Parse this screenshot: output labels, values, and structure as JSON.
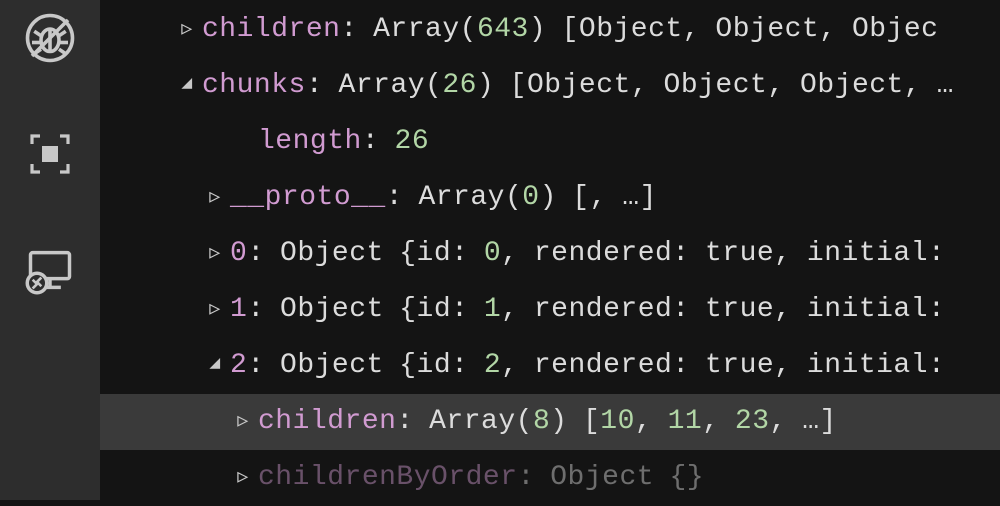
{
  "sidebar": {
    "icons": [
      "no-bug",
      "expand-region",
      "remote"
    ]
  },
  "rows": [
    {
      "indent": 72,
      "twisty": "closed",
      "highlight": false,
      "faded": false,
      "tokens": [
        [
          "key",
          "children"
        ],
        [
          "punc",
          ":"
        ],
        [
          "sp",
          ""
        ],
        [
          "type",
          "Array"
        ],
        [
          "punc",
          "("
        ],
        [
          "num",
          "643"
        ],
        [
          "punc",
          ")"
        ],
        [
          "sp",
          ""
        ],
        [
          "punc",
          "["
        ],
        [
          "type",
          "Object"
        ],
        [
          "punc",
          ","
        ],
        [
          "sp",
          ""
        ],
        [
          "type",
          "Object"
        ],
        [
          "punc",
          ","
        ],
        [
          "sp",
          ""
        ],
        [
          "type",
          "Objec"
        ]
      ]
    },
    {
      "indent": 72,
      "twisty": "open",
      "highlight": false,
      "faded": false,
      "tokens": [
        [
          "key",
          "chunks"
        ],
        [
          "punc",
          ":"
        ],
        [
          "sp",
          ""
        ],
        [
          "type",
          "Array"
        ],
        [
          "punc",
          "("
        ],
        [
          "num",
          "26"
        ],
        [
          "punc",
          ")"
        ],
        [
          "sp",
          ""
        ],
        [
          "punc",
          "["
        ],
        [
          "type",
          "Object"
        ],
        [
          "punc",
          ","
        ],
        [
          "sp",
          ""
        ],
        [
          "type",
          "Object"
        ],
        [
          "punc",
          ","
        ],
        [
          "sp",
          ""
        ],
        [
          "type",
          "Object"
        ],
        [
          "punc",
          ","
        ],
        [
          "sp",
          ""
        ],
        [
          "punc",
          "…"
        ]
      ]
    },
    {
      "indent": 128,
      "twisty": "none",
      "highlight": false,
      "faded": false,
      "tokens": [
        [
          "key",
          "length"
        ],
        [
          "punc",
          ":"
        ],
        [
          "sp",
          ""
        ],
        [
          "num",
          "26"
        ]
      ]
    },
    {
      "indent": 100,
      "twisty": "closed",
      "highlight": false,
      "faded": false,
      "tokens": [
        [
          "key",
          "__proto__"
        ],
        [
          "punc",
          ":"
        ],
        [
          "sp",
          ""
        ],
        [
          "type",
          "Array"
        ],
        [
          "punc",
          "("
        ],
        [
          "num",
          "0"
        ],
        [
          "punc",
          ")"
        ],
        [
          "sp",
          ""
        ],
        [
          "punc",
          "[,"
        ],
        [
          "sp",
          ""
        ],
        [
          "punc",
          "…]"
        ]
      ]
    },
    {
      "indent": 100,
      "twisty": "closed",
      "highlight": false,
      "faded": false,
      "tokens": [
        [
          "key",
          "0"
        ],
        [
          "punc",
          ":"
        ],
        [
          "sp",
          ""
        ],
        [
          "type",
          "Object"
        ],
        [
          "sp",
          ""
        ],
        [
          "punc",
          "{"
        ],
        [
          "literal",
          "id"
        ],
        [
          "punc",
          ":"
        ],
        [
          "sp",
          ""
        ],
        [
          "num",
          "0"
        ],
        [
          "punc",
          ","
        ],
        [
          "sp",
          ""
        ],
        [
          "literal",
          "rendered"
        ],
        [
          "punc",
          ":"
        ],
        [
          "sp",
          ""
        ],
        [
          "bool",
          "true"
        ],
        [
          "punc",
          ","
        ],
        [
          "sp",
          ""
        ],
        [
          "literal",
          "initial"
        ],
        [
          "punc",
          ":"
        ]
      ]
    },
    {
      "indent": 100,
      "twisty": "closed",
      "highlight": false,
      "faded": false,
      "tokens": [
        [
          "key",
          "1"
        ],
        [
          "punc",
          ":"
        ],
        [
          "sp",
          ""
        ],
        [
          "type",
          "Object"
        ],
        [
          "sp",
          ""
        ],
        [
          "punc",
          "{"
        ],
        [
          "literal",
          "id"
        ],
        [
          "punc",
          ":"
        ],
        [
          "sp",
          ""
        ],
        [
          "num",
          "1"
        ],
        [
          "punc",
          ","
        ],
        [
          "sp",
          ""
        ],
        [
          "literal",
          "rendered"
        ],
        [
          "punc",
          ":"
        ],
        [
          "sp",
          ""
        ],
        [
          "bool",
          "true"
        ],
        [
          "punc",
          ","
        ],
        [
          "sp",
          ""
        ],
        [
          "literal",
          "initial"
        ],
        [
          "punc",
          ":"
        ]
      ]
    },
    {
      "indent": 100,
      "twisty": "open",
      "highlight": false,
      "faded": false,
      "tokens": [
        [
          "key",
          "2"
        ],
        [
          "punc",
          ":"
        ],
        [
          "sp",
          ""
        ],
        [
          "type",
          "Object"
        ],
        [
          "sp",
          ""
        ],
        [
          "punc",
          "{"
        ],
        [
          "literal",
          "id"
        ],
        [
          "punc",
          ":"
        ],
        [
          "sp",
          ""
        ],
        [
          "num",
          "2"
        ],
        [
          "punc",
          ","
        ],
        [
          "sp",
          ""
        ],
        [
          "literal",
          "rendered"
        ],
        [
          "punc",
          ":"
        ],
        [
          "sp",
          ""
        ],
        [
          "bool",
          "true"
        ],
        [
          "punc",
          ","
        ],
        [
          "sp",
          ""
        ],
        [
          "literal",
          "initial"
        ],
        [
          "punc",
          ":"
        ]
      ]
    },
    {
      "indent": 128,
      "twisty": "closed",
      "highlight": true,
      "faded": false,
      "tokens": [
        [
          "key",
          "children"
        ],
        [
          "punc",
          ":"
        ],
        [
          "sp",
          ""
        ],
        [
          "type",
          "Array"
        ],
        [
          "punc",
          "("
        ],
        [
          "num",
          "8"
        ],
        [
          "punc",
          ")"
        ],
        [
          "sp",
          ""
        ],
        [
          "punc",
          "["
        ],
        [
          "num",
          "10"
        ],
        [
          "punc",
          ","
        ],
        [
          "sp",
          ""
        ],
        [
          "num",
          "11"
        ],
        [
          "punc",
          ","
        ],
        [
          "sp",
          ""
        ],
        [
          "num",
          "23"
        ],
        [
          "punc",
          ","
        ],
        [
          "sp",
          ""
        ],
        [
          "punc",
          "…]"
        ]
      ]
    },
    {
      "indent": 128,
      "twisty": "closed",
      "highlight": false,
      "faded": true,
      "tokens": [
        [
          "key",
          "childrenByOrder"
        ],
        [
          "punc",
          ":"
        ],
        [
          "sp",
          ""
        ],
        [
          "type",
          "Object"
        ],
        [
          "sp",
          ""
        ],
        [
          "punc",
          "{}"
        ]
      ]
    }
  ],
  "twisty_glyphs": {
    "closed": "▹",
    "open": "◢",
    "none": ""
  }
}
